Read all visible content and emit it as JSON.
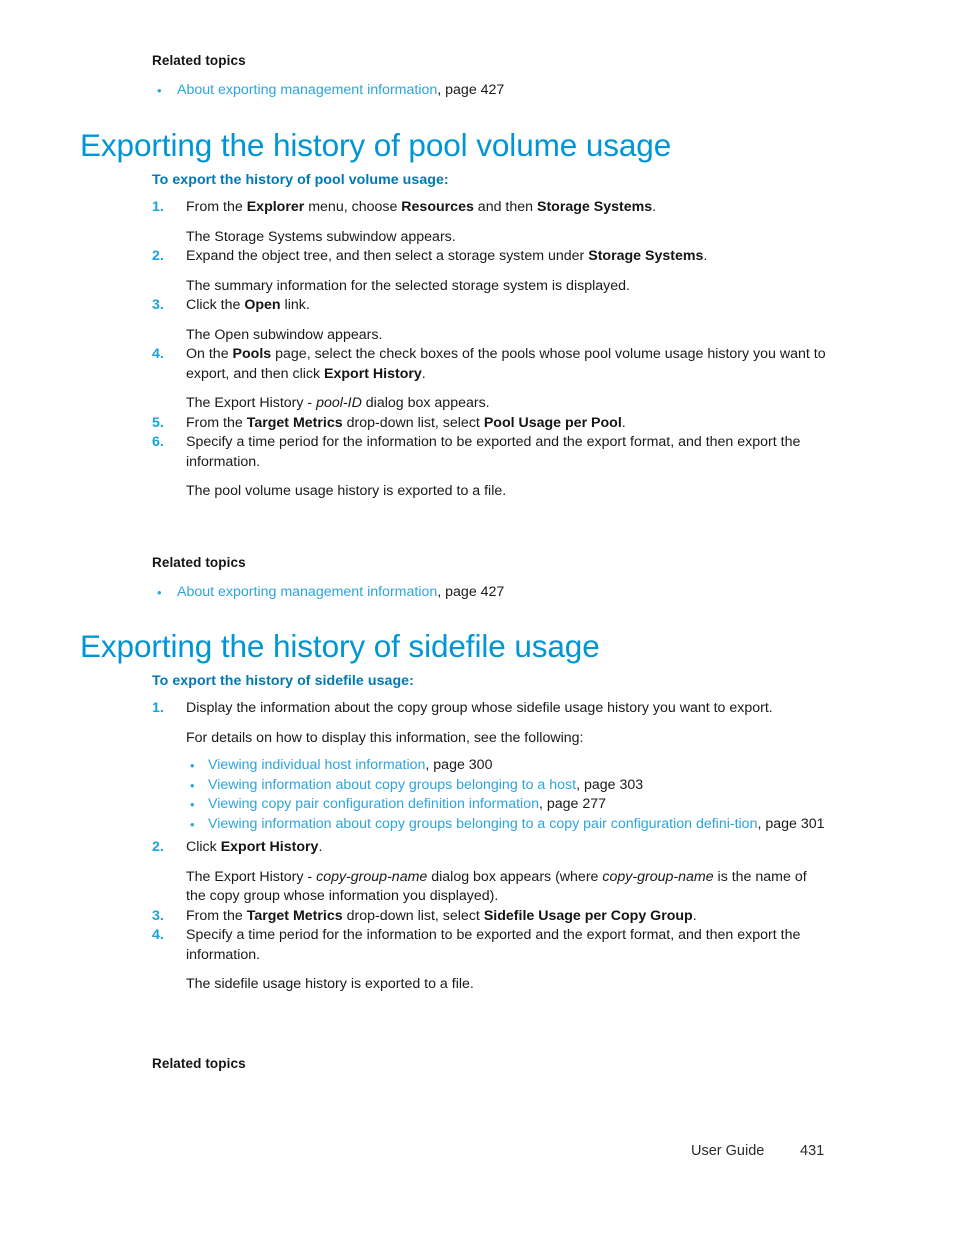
{
  "page": {
    "footer_label": "User Guide",
    "footer_page_number": "431",
    "colors": {
      "heading_blue": "#0096d6",
      "subheading_blue": "#0078b4",
      "link_blue": "#2ca4dc",
      "step_number_blue": "#17a3dc",
      "body_text": "#1a1a1a",
      "background": "#ffffff"
    }
  },
  "related_topics_top": {
    "title": "Related topics",
    "items": [
      {
        "bullet": "•",
        "link": "About exporting management information",
        "suffix": ", page 427"
      }
    ]
  },
  "section_pool": {
    "heading": "Exporting the history of pool volume usage",
    "lead_in": "To export the history of pool volume usage:",
    "steps": [
      {
        "number": "1.",
        "text_parts": [
          {
            "t": "From the ",
            "style": "plain"
          },
          {
            "t": "Explorer",
            "style": "bold"
          },
          {
            "t": " menu, choose ",
            "style": "plain"
          },
          {
            "t": "Resources",
            "style": "bold"
          },
          {
            "t": " and then ",
            "style": "plain"
          },
          {
            "t": "Storage Systems",
            "style": "bold"
          },
          {
            "t": ".",
            "style": "plain"
          }
        ],
        "result": "The Storage Systems subwindow appears."
      },
      {
        "number": "2.",
        "text_parts": [
          {
            "t": "Expand the object tree, and then select a storage system under ",
            "style": "plain"
          },
          {
            "t": "Storage Systems",
            "style": "bold"
          },
          {
            "t": ".",
            "style": "plain"
          }
        ],
        "result": "The summary information for the selected storage system is displayed."
      },
      {
        "number": "3.",
        "text_parts": [
          {
            "t": "Click the ",
            "style": "plain"
          },
          {
            "t": "Open",
            "style": "bold"
          },
          {
            "t": " link.",
            "style": "plain"
          }
        ],
        "result": "The Open subwindow appears."
      },
      {
        "number": "4.",
        "text_parts": [
          {
            "t": "On the ",
            "style": "plain"
          },
          {
            "t": "Pools",
            "style": "bold"
          },
          {
            "t": " page, select the check boxes of the pools whose pool volume usage history you want to export, and then click ",
            "style": "plain"
          },
          {
            "t": "Export History",
            "style": "bold"
          },
          {
            "t": ".",
            "style": "plain"
          }
        ],
        "result_parts": [
          {
            "t": "The Export History - ",
            "style": "plain"
          },
          {
            "t": "pool-ID",
            "style": "italic"
          },
          {
            "t": " dialog box appears.",
            "style": "plain"
          }
        ]
      },
      {
        "number": "5.",
        "text_parts": [
          {
            "t": "From the ",
            "style": "plain"
          },
          {
            "t": "Target Metrics",
            "style": "bold"
          },
          {
            "t": " drop-down list, select ",
            "style": "plain"
          },
          {
            "t": "Pool Usage per Pool",
            "style": "bold"
          },
          {
            "t": ".",
            "style": "plain"
          }
        ]
      },
      {
        "number": "6.",
        "text_parts": [
          {
            "t": "Specify a time period for the information to be exported and the export format, and then export the information.",
            "style": "plain"
          }
        ],
        "result": "The pool volume usage history is exported to a file."
      }
    ],
    "related_topics": {
      "title": "Related topics",
      "items": [
        {
          "bullet": "•",
          "link": "About exporting management information",
          "suffix": ", page 427"
        }
      ]
    }
  },
  "section_sidefile": {
    "heading": "Exporting the history of sidefile usage",
    "lead_in": "To export the history of sidefile usage:",
    "step1": {
      "number": "1.",
      "text": "Display the information about the copy group whose sidefile usage history you want to export.",
      "detail_intro": "For details on how to display this information, see the following:",
      "links": [
        {
          "bullet": "•",
          "link": "Viewing individual host information",
          "suffix": ", page 300"
        },
        {
          "bullet": "•",
          "link": "Viewing information about copy groups belonging to a host",
          "suffix": ", page 303"
        },
        {
          "bullet": "•",
          "link": "Viewing copy pair configuration definition information",
          "suffix": ", page 277"
        },
        {
          "bullet": "•",
          "link": "Viewing information about copy groups belonging to a copy pair configuration defini-tion",
          "suffix": ", page 301"
        }
      ]
    },
    "steps": [
      {
        "number": "2.",
        "text_parts": [
          {
            "t": "Click ",
            "style": "plain"
          },
          {
            "t": "Export History",
            "style": "bold"
          },
          {
            "t": ".",
            "style": "plain"
          }
        ],
        "result_parts": [
          {
            "t": "The Export History - ",
            "style": "plain"
          },
          {
            "t": "copy-group-name",
            "style": "italic"
          },
          {
            "t": " dialog box appears (where ",
            "style": "plain"
          },
          {
            "t": "copy-group-name",
            "style": "italic"
          },
          {
            "t": " is the name of the copy group whose information you displayed).",
            "style": "plain"
          }
        ]
      },
      {
        "number": "3.",
        "text_parts": [
          {
            "t": "From the ",
            "style": "plain"
          },
          {
            "t": "Target Metrics",
            "style": "bold"
          },
          {
            "t": " drop-down list, select ",
            "style": "plain"
          },
          {
            "t": "Sidefile Usage per Copy Group",
            "style": "bold"
          },
          {
            "t": ".",
            "style": "plain"
          }
        ]
      },
      {
        "number": "4.",
        "text_parts": [
          {
            "t": "Specify a time period for the information to be exported and the export format, and then export the information.",
            "style": "plain"
          }
        ],
        "result": "The sidefile usage history is exported to a file."
      }
    ],
    "related_topics": {
      "title": "Related topics"
    }
  }
}
